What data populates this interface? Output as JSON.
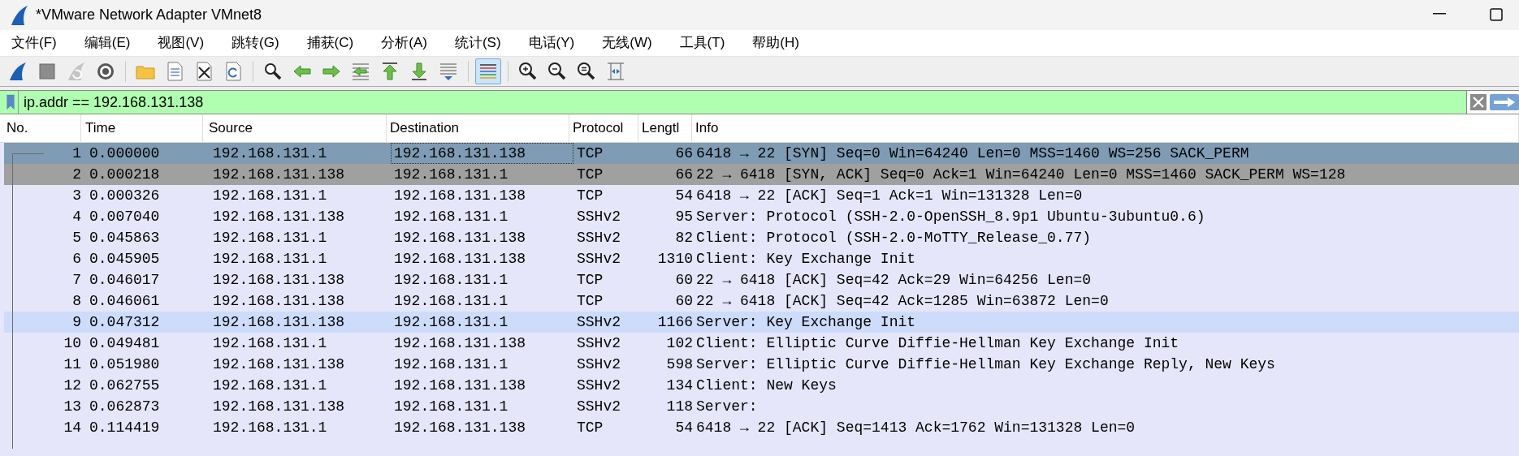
{
  "window": {
    "title": "*VMware Network Adapter VMnet8"
  },
  "menu": [
    "文件(F)",
    "编辑(E)",
    "视图(V)",
    "跳转(G)",
    "捕获(C)",
    "分析(A)",
    "统计(S)",
    "电话(Y)",
    "无线(W)",
    "工具(T)",
    "帮助(H)"
  ],
  "toolbar": [
    {
      "kind": "fin",
      "selected": false
    },
    {
      "kind": "stop",
      "selected": false
    },
    {
      "kind": "restart",
      "selected": false
    },
    {
      "kind": "options",
      "selected": false
    },
    {
      "kind": "separator"
    },
    {
      "kind": "open",
      "selected": false
    },
    {
      "kind": "save",
      "selected": false
    },
    {
      "kind": "close",
      "selected": false
    },
    {
      "kind": "reload",
      "selected": false
    },
    {
      "kind": "separator"
    },
    {
      "kind": "find",
      "selected": false
    },
    {
      "kind": "back",
      "selected": false
    },
    {
      "kind": "forward",
      "selected": false
    },
    {
      "kind": "goto",
      "selected": false
    },
    {
      "kind": "first",
      "selected": false
    },
    {
      "kind": "last",
      "selected": false
    },
    {
      "kind": "autoscroll",
      "selected": false
    },
    {
      "kind": "separator"
    },
    {
      "kind": "colorize",
      "selected": true
    },
    {
      "kind": "separator"
    },
    {
      "kind": "zoom-in",
      "selected": false
    },
    {
      "kind": "zoom-out",
      "selected": false
    },
    {
      "kind": "zoom-reset",
      "selected": false
    },
    {
      "kind": "resize",
      "selected": false
    }
  ],
  "filter": {
    "value": "ip.addr == 192.168.131.138"
  },
  "table": {
    "columns": [
      "No.",
      "Time",
      "Source",
      "Destination",
      "Protocol",
      "Lengtl",
      "Info"
    ],
    "rows": [
      {
        "no": "1",
        "time": "0.000000",
        "source": "192.168.131.1",
        "destination": "192.168.131.138",
        "protocol": "TCP",
        "length": "66",
        "info": "6418 → 22 [SYN] Seq=0 Win=64240 Len=0 MSS=1460 WS=256 SACK_PERM",
        "selected": true,
        "related": false,
        "hovered": false,
        "focused": true
      },
      {
        "no": "2",
        "time": "0.000218",
        "source": "192.168.131.138",
        "destination": "192.168.131.1",
        "protocol": "TCP",
        "length": "66",
        "info": "22 → 6418 [SYN, ACK] Seq=0 Ack=1 Win=64240 Len=0 MSS=1460 SACK_PERM WS=128",
        "selected": false,
        "related": true,
        "hovered": false,
        "focused": false
      },
      {
        "no": "3",
        "time": "0.000326",
        "source": "192.168.131.1",
        "destination": "192.168.131.138",
        "protocol": "TCP",
        "length": "54",
        "info": "6418 → 22 [ACK] Seq=1 Ack=1 Win=131328 Len=0",
        "selected": false,
        "related": false,
        "hovered": false,
        "focused": false
      },
      {
        "no": "4",
        "time": "0.007040",
        "source": "192.168.131.138",
        "destination": "192.168.131.1",
        "protocol": "SSHv2",
        "length": "95",
        "info": "Server: Protocol (SSH-2.0-OpenSSH_8.9p1 Ubuntu-3ubuntu0.6)",
        "selected": false,
        "related": false,
        "hovered": false,
        "focused": false
      },
      {
        "no": "5",
        "time": "0.045863",
        "source": "192.168.131.1",
        "destination": "192.168.131.138",
        "protocol": "SSHv2",
        "length": "82",
        "info": "Client: Protocol (SSH-2.0-MoTTY_Release_0.77)",
        "selected": false,
        "related": false,
        "hovered": false,
        "focused": false
      },
      {
        "no": "6",
        "time": "0.045905",
        "source": "192.168.131.1",
        "destination": "192.168.131.138",
        "protocol": "SSHv2",
        "length": "1310",
        "info": "Client: Key Exchange Init",
        "selected": false,
        "related": false,
        "hovered": false,
        "focused": false
      },
      {
        "no": "7",
        "time": "0.046017",
        "source": "192.168.131.138",
        "destination": "192.168.131.1",
        "protocol": "TCP",
        "length": "60",
        "info": "22 → 6418 [ACK] Seq=42 Ack=29 Win=64256 Len=0",
        "selected": false,
        "related": false,
        "hovered": false,
        "focused": false
      },
      {
        "no": "8",
        "time": "0.046061",
        "source": "192.168.131.138",
        "destination": "192.168.131.1",
        "protocol": "TCP",
        "length": "60",
        "info": "22 → 6418 [ACK] Seq=42 Ack=1285 Win=63872 Len=0",
        "selected": false,
        "related": false,
        "hovered": false,
        "focused": false
      },
      {
        "no": "9",
        "time": "0.047312",
        "source": "192.168.131.138",
        "destination": "192.168.131.1",
        "protocol": "SSHv2",
        "length": "1166",
        "info": "Server: Key Exchange Init",
        "selected": false,
        "related": false,
        "hovered": true,
        "focused": false
      },
      {
        "no": "10",
        "time": "0.049481",
        "source": "192.168.131.1",
        "destination": "192.168.131.138",
        "protocol": "SSHv2",
        "length": "102",
        "info": "Client: Elliptic Curve Diffie-Hellman Key Exchange Init",
        "selected": false,
        "related": false,
        "hovered": false,
        "focused": false
      },
      {
        "no": "11",
        "time": "0.051980",
        "source": "192.168.131.138",
        "destination": "192.168.131.1",
        "protocol": "SSHv2",
        "length": "598",
        "info": "Server: Elliptic Curve Diffie-Hellman Key Exchange Reply, New Keys",
        "selected": false,
        "related": false,
        "hovered": false,
        "focused": false
      },
      {
        "no": "12",
        "time": "0.062755",
        "source": "192.168.131.1",
        "destination": "192.168.131.138",
        "protocol": "SSHv2",
        "length": "134",
        "info": "Client: New Keys",
        "selected": false,
        "related": false,
        "hovered": false,
        "focused": false
      },
      {
        "no": "13",
        "time": "0.062873",
        "source": "192.168.131.138",
        "destination": "192.168.131.1",
        "protocol": "SSHv2",
        "length": "118",
        "info": "Server:",
        "selected": false,
        "related": false,
        "hovered": false,
        "focused": false
      },
      {
        "no": "14",
        "time": "0.114419",
        "source": "192.168.131.1",
        "destination": "192.168.131.138",
        "protocol": "TCP",
        "length": "54",
        "info": "6418 → 22 [ACK] Seq=1413 Ack=1762 Win=131328 Len=0",
        "selected": false,
        "related": false,
        "hovered": false,
        "focused": false
      }
    ]
  }
}
